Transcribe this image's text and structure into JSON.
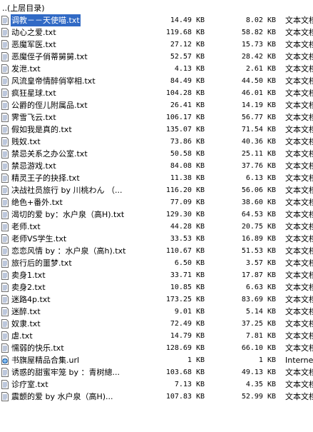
{
  "parent_label": "..(上层目录)",
  "selected_index": 0,
  "files": [
    {
      "name": "调教－－天使喵.txt",
      "size": "14.49 KB",
      "packed": "8.02 KB",
      "type": "文本文档",
      "icon": "text-file-icon"
    },
    {
      "name": "动心之爱.txt",
      "size": "119.68 KB",
      "packed": "58.82 KB",
      "type": "文本文档",
      "icon": "text-file-icon"
    },
    {
      "name": "恶魔军医.txt",
      "size": "27.12 KB",
      "packed": "15.73 KB",
      "type": "文本文档",
      "icon": "text-file-icon"
    },
    {
      "name": "恶魔侄子俏蒂舅舅.txt",
      "size": "52.57 KB",
      "packed": "28.42 KB",
      "type": "文本文档",
      "icon": "text-file-icon"
    },
    {
      "name": "发泄.txt",
      "size": "4.13 KB",
      "packed": "2.61 KB",
      "type": "文本文档",
      "icon": "text-file-icon"
    },
    {
      "name": "风流皇帝情醉俏宰相.txt",
      "size": "84.49 KB",
      "packed": "44.50 KB",
      "type": "文本文档",
      "icon": "text-file-icon"
    },
    {
      "name": "疯狂星球.txt",
      "size": "104.28 KB",
      "packed": "46.01 KB",
      "type": "文本文档",
      "icon": "text-file-icon"
    },
    {
      "name": "公爵的侄儿附属品.txt",
      "size": "26.41 KB",
      "packed": "14.19 KB",
      "type": "文本文档",
      "icon": "text-file-icon"
    },
    {
      "name": "霁雪飞云.txt",
      "size": "106.17 KB",
      "packed": "56.77 KB",
      "type": "文本文档",
      "icon": "text-file-icon"
    },
    {
      "name": "假如我是真的.txt",
      "size": "135.07 KB",
      "packed": "71.54 KB",
      "type": "文本文档",
      "icon": "text-file-icon"
    },
    {
      "name": "贱奴.txt",
      "size": "73.86 KB",
      "packed": "40.36 KB",
      "type": "文本文档",
      "icon": "text-file-icon"
    },
    {
      "name": "禁忌关系之办公室.txt",
      "size": "50.58 KB",
      "packed": "25.11 KB",
      "type": "文本文档",
      "icon": "text-file-icon"
    },
    {
      "name": "禁忌游戏.txt",
      "size": "84.08 KB",
      "packed": "37.76 KB",
      "type": "文本文档",
      "icon": "text-file-icon"
    },
    {
      "name": "精灵王子的抉择.txt",
      "size": "11.38 KB",
      "packed": "6.13 KB",
      "type": "文本文档",
      "icon": "text-file-icon"
    },
    {
      "name": "决战社员旅行 by 川桃わん （...",
      "size": "116.20 KB",
      "packed": "56.06 KB",
      "type": "文本文档",
      "icon": "text-file-icon"
    },
    {
      "name": "绝色+番外.txt",
      "size": "77.09 KB",
      "packed": "38.60 KB",
      "type": "文本文档",
      "icon": "text-file-icon"
    },
    {
      "name": "渴切的爱 by：水户泉（高H).txt",
      "size": "129.30 KB",
      "packed": "64.53 KB",
      "type": "文本文档",
      "icon": "text-file-icon"
    },
    {
      "name": "老师.txt",
      "size": "44.28 KB",
      "packed": "20.75 KB",
      "type": "文本文档",
      "icon": "text-file-icon"
    },
    {
      "name": "老师VS学生.txt",
      "size": "33.53 KB",
      "packed": "16.89 KB",
      "type": "文本文档",
      "icon": "text-file-icon"
    },
    {
      "name": "恋恋风情 by ：水户泉（高h).txt",
      "size": "110.67 KB",
      "packed": "51.53 KB",
      "type": "文本文档",
      "icon": "text-file-icon"
    },
    {
      "name": "旅行后的噩梦.txt",
      "size": "6.50 KB",
      "packed": "3.57 KB",
      "type": "文本文档",
      "icon": "text-file-icon"
    },
    {
      "name": "卖身1.txt",
      "size": "33.71 KB",
      "packed": "17.87 KB",
      "type": "文本文档",
      "icon": "text-file-icon"
    },
    {
      "name": "卖身2.txt",
      "size": "10.85 KB",
      "packed": "6.63 KB",
      "type": "文本文档",
      "icon": "text-file-icon"
    },
    {
      "name": "迷路4p.txt",
      "size": "173.25 KB",
      "packed": "83.69 KB",
      "type": "文本文档",
      "icon": "text-file-icon"
    },
    {
      "name": "迷醉.txt",
      "size": "9.01 KB",
      "packed": "5.14 KB",
      "type": "文本文档",
      "icon": "text-file-icon"
    },
    {
      "name": "奴隶.txt",
      "size": "72.49 KB",
      "packed": "37.25 KB",
      "type": "文本文档",
      "icon": "text-file-icon"
    },
    {
      "name": "虐.txt",
      "size": "14.79 KB",
      "packed": "7.81 KB",
      "type": "文本文档",
      "icon": "text-file-icon"
    },
    {
      "name": "懦弱的快乐.txt",
      "size": "128.69 KB",
      "packed": "66.10 KB",
      "type": "文本文档",
      "icon": "text-file-icon"
    },
    {
      "name": "书旗屋精品合集.url",
      "size": "1 KB",
      "packed": "1 KB",
      "type": "Internet",
      "icon": "url-file-icon"
    },
    {
      "name": "诱惑的甜蜜牢笼 by ：青树總...",
      "size": "103.68 KB",
      "packed": "49.13 KB",
      "type": "文本文档",
      "icon": "text-file-icon"
    },
    {
      "name": "诊疗室.txt",
      "size": "7.13 KB",
      "packed": "4.35 KB",
      "type": "文本文档",
      "icon": "text-file-icon"
    },
    {
      "name": "震颤的爱 by 水户泉（高H)...",
      "size": "107.83 KB",
      "packed": "52.99 KB",
      "type": "文本文档",
      "icon": "text-file-icon"
    }
  ]
}
